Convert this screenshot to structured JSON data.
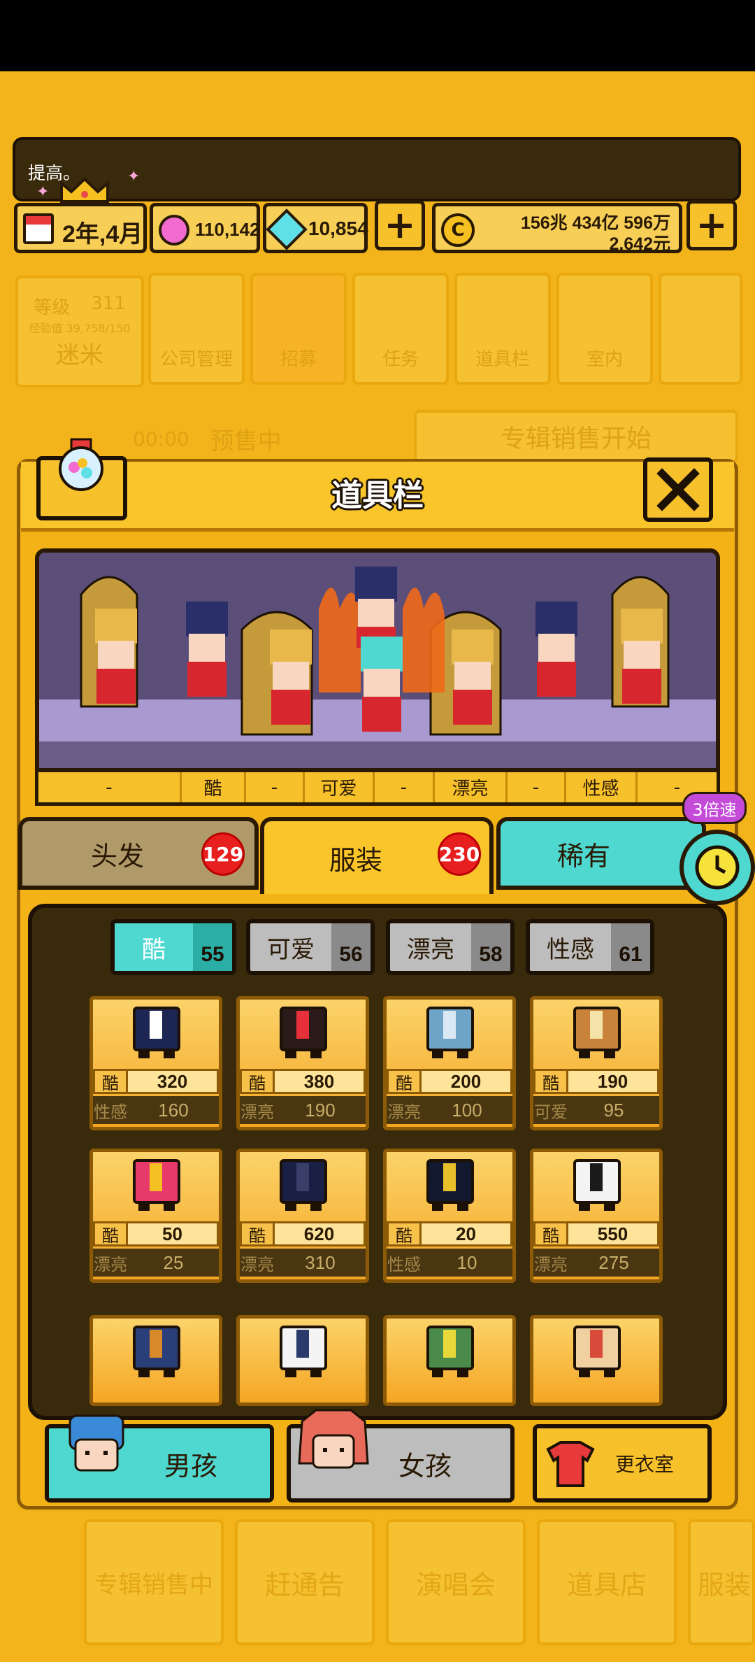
{
  "message": "提高。",
  "status": {
    "date": "2年,4月",
    "gems_pink": "110,142",
    "gems_blue": "10,854",
    "money_line1": "156兆 434亿 596万",
    "money_line2": "2,642元"
  },
  "bg_menu": {
    "level_label": "等级",
    "level_value": "311",
    "exp_text": "经验值 39,758/150",
    "fans_label": "迷米",
    "items": [
      "公司管理",
      "招募",
      "任务",
      "道具栏",
      "室内"
    ],
    "timer": "00:00",
    "presale": "预售中",
    "album_start": "专辑销售开始",
    "bottom_items": [
      "专辑销售中",
      "赶通告",
      "演唱会",
      "道具店",
      "服装"
    ]
  },
  "modal": {
    "title": "道具栏"
  },
  "stage_labels": [
    "-",
    "酷",
    "-",
    "可爱",
    "-",
    "漂亮",
    "-",
    "性感",
    "-"
  ],
  "tabs": [
    {
      "label": "头发",
      "count": "129"
    },
    {
      "label": "服装",
      "count": "230"
    },
    {
      "label": "稀有",
      "count": ""
    }
  ],
  "speed_label": "3倍速",
  "filters": [
    {
      "label": "酷",
      "count": "55"
    },
    {
      "label": "可爱",
      "count": "56"
    },
    {
      "label": "漂亮",
      "count": "58"
    },
    {
      "label": "性感",
      "count": "61"
    }
  ],
  "items": [
    {
      "s1k": "酷",
      "s1v": "320",
      "s2k": "性感",
      "s2v": "160",
      "color": "#1d2552",
      "accent": "#ffffff"
    },
    {
      "s1k": "酷",
      "s1v": "380",
      "s2k": "漂亮",
      "s2v": "190",
      "color": "#2a1a1a",
      "accent": "#e8303a"
    },
    {
      "s1k": "酷",
      "s1v": "200",
      "s2k": "漂亮",
      "s2v": "100",
      "color": "#6fa4c9",
      "accent": "#d9e8f2"
    },
    {
      "s1k": "酷",
      "s1v": "190",
      "s2k": "可爱",
      "s2v": "95",
      "color": "#c8823a",
      "accent": "#f5e2a8"
    },
    {
      "s1k": "酷",
      "s1v": "50",
      "s2k": "漂亮",
      "s2v": "25",
      "color": "#e83a6a",
      "accent": "#f5c022"
    },
    {
      "s1k": "酷",
      "s1v": "620",
      "s2k": "漂亮",
      "s2v": "310",
      "color": "#1a1f45",
      "accent": "#3a3f6a"
    },
    {
      "s1k": "酷",
      "s1v": "20",
      "s2k": "性感",
      "s2v": "10",
      "color": "#111830",
      "accent": "#e8c02a"
    },
    {
      "s1k": "酷",
      "s1v": "550",
      "s2k": "漂亮",
      "s2v": "275",
      "color": "#f4f4f4",
      "accent": "#1a1a1a"
    },
    {
      "s1k": "",
      "s1v": "",
      "s2k": "",
      "s2v": "",
      "color": "#2a3e7a",
      "accent": "#d88a2a"
    },
    {
      "s1k": "",
      "s1v": "",
      "s2k": "",
      "s2v": "",
      "color": "#f4f4f4",
      "accent": "#2a3a6a"
    },
    {
      "s1k": "",
      "s1v": "",
      "s2k": "",
      "s2v": "",
      "color": "#4a8a4a",
      "accent": "#e8d83a"
    },
    {
      "s1k": "",
      "s1v": "",
      "s2k": "",
      "s2v": "",
      "color": "#f0d0a0",
      "accent": "#d84a3a"
    }
  ],
  "bottom_buttons": {
    "boy": "男孩",
    "girl": "女孩",
    "wardrobe": "更衣室"
  },
  "colors": {
    "accent_cyan": "#4ed8d0",
    "badge_red": "#e81f1f",
    "panel_dark": "#3a2a0c",
    "gold": "#f3b215"
  }
}
